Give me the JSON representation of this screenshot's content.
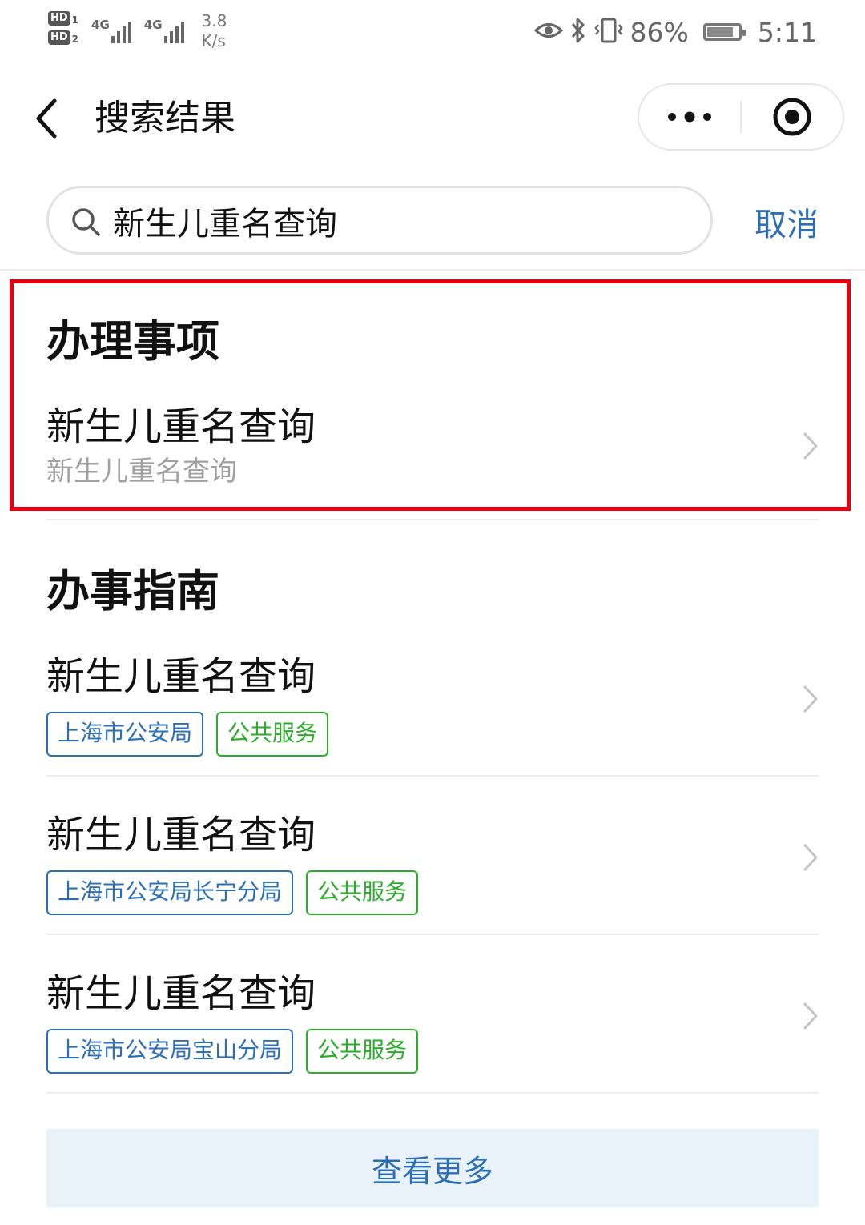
{
  "status_bar": {
    "hd1": "HD",
    "hd1_num": "1",
    "hd2": "HD",
    "hd2_num": "2",
    "signal1_label": "4G",
    "signal2_label": "4G",
    "speed_value": "3.8",
    "speed_unit": "K/s",
    "battery_percent": "86%",
    "battery_level": 0.86,
    "time": "5:11",
    "icons": [
      "eye-icon",
      "bluetooth-icon",
      "vibrate-icon",
      "battery-icon"
    ]
  },
  "nav": {
    "title": "搜索结果",
    "icons": [
      "back-icon",
      "more-dots-icon",
      "close-target-icon"
    ]
  },
  "search": {
    "query": "新生儿重名查询",
    "cancel_label": "取消",
    "icon": "search-icon"
  },
  "handling": {
    "heading": "办理事项",
    "item": {
      "title": "新生儿重名查询",
      "subtitle": "新生儿重名查询"
    }
  },
  "guide": {
    "heading": "办事指南",
    "items": [
      {
        "title": "新生儿重名查询",
        "tags": [
          "上海市公安局",
          "公共服务"
        ]
      },
      {
        "title": "新生儿重名查询",
        "tags": [
          "上海市公安局长宁分局",
          "公共服务"
        ]
      },
      {
        "title": "新生儿重名查询",
        "tags": [
          "上海市公安局宝山分局",
          "公共服务"
        ]
      }
    ]
  },
  "more_label": "查看更多",
  "colors": {
    "accent_blue": "#2a6fb8",
    "tag_green": "#2aae2a",
    "highlight_red": "#e60012",
    "more_bg": "#e9f1f9"
  }
}
